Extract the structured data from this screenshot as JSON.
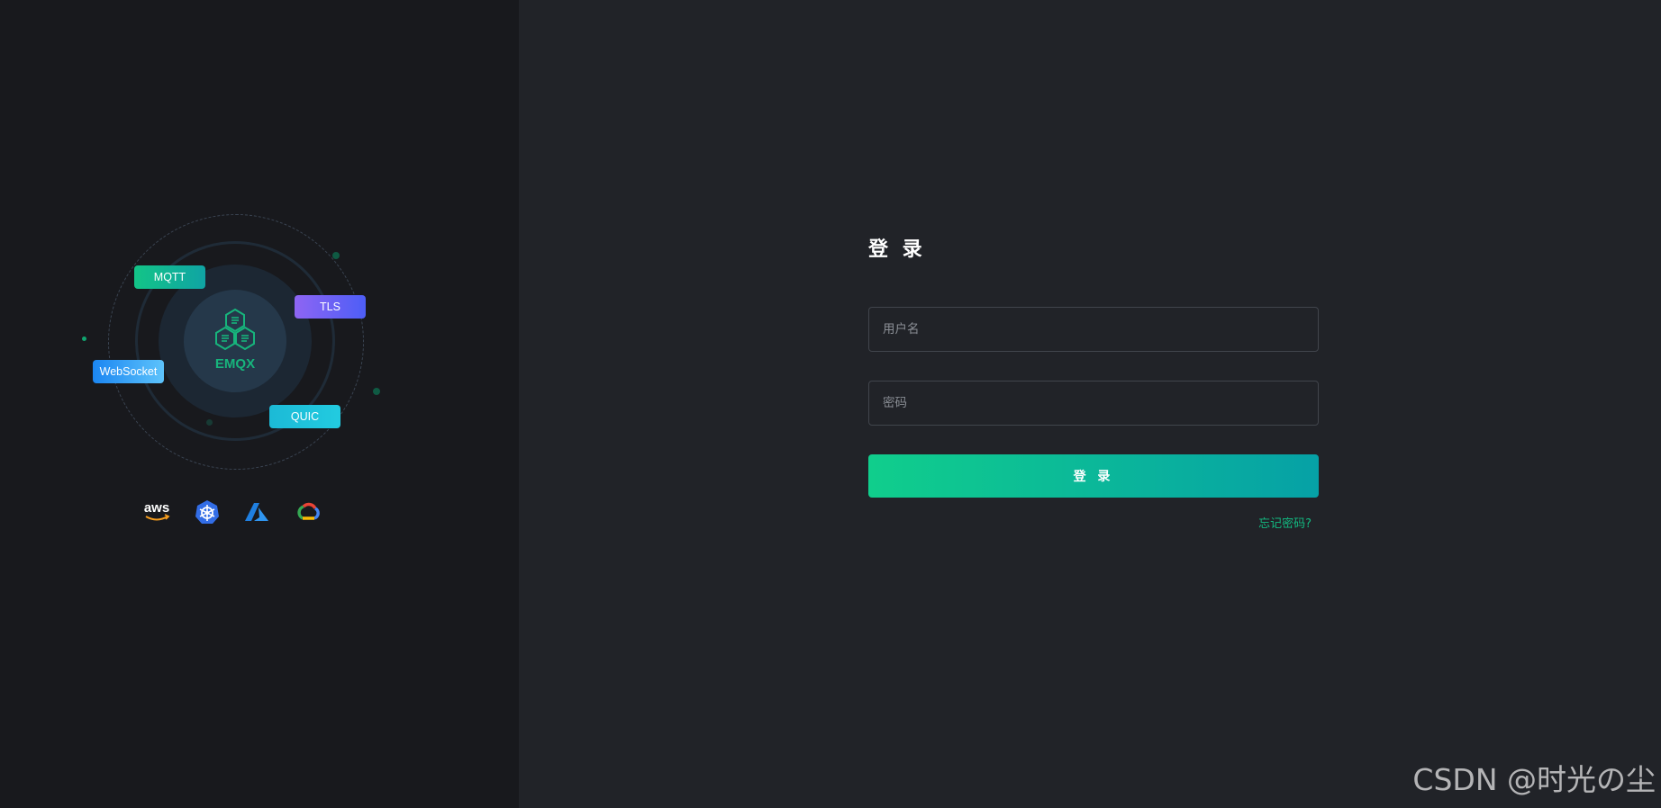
{
  "illustration": {
    "core_label": "EMQX",
    "protocols": [
      "MQTT",
      "TLS",
      "WebSocket",
      "QUIC"
    ],
    "cloud_icons": [
      "aws-logo-icon",
      "kubernetes-icon",
      "azure-icon",
      "google-cloud-icon"
    ],
    "aws_text": "aws"
  },
  "login": {
    "title": "登 录",
    "username_placeholder": "用户名",
    "password_placeholder": "密码",
    "submit_label": "登 录",
    "forgot_label": "忘记密码?"
  },
  "watermark": "CSDN @时光の尘",
  "colors": {
    "accent": "#13b981",
    "left_bg": "#18191d",
    "right_bg": "#212328"
  }
}
